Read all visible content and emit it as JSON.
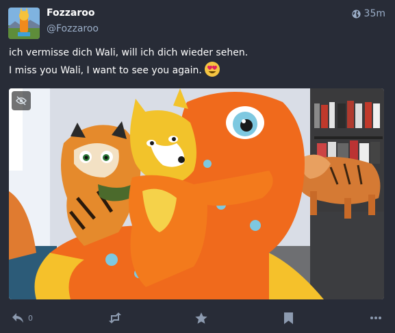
{
  "status": {
    "display_name": "Fozzaroo",
    "account": "@Fozzaroo",
    "visibility_icon": "globe-icon",
    "time": "35m",
    "content_lines": [
      "ich vermisse dich Wali, will ich dich wieder sehen.",
      "I miss you Wali, I want to see you again."
    ],
    "emoji": "heart-eyes-emoji",
    "media": {
      "type": "photo",
      "hide_icon": "eye-slash-icon"
    },
    "actions": {
      "reply_icon": "reply-icon",
      "reply_count": "0",
      "boost_icon": "retweet-icon",
      "favourite_icon": "star-icon",
      "bookmark_icon": "bookmark-icon",
      "more_icon": "ellipsis-icon"
    }
  },
  "colors": {
    "background": "#282c37",
    "text": "#ffffff",
    "secondary": "#9baec8",
    "action": "#8d9bb0"
  }
}
